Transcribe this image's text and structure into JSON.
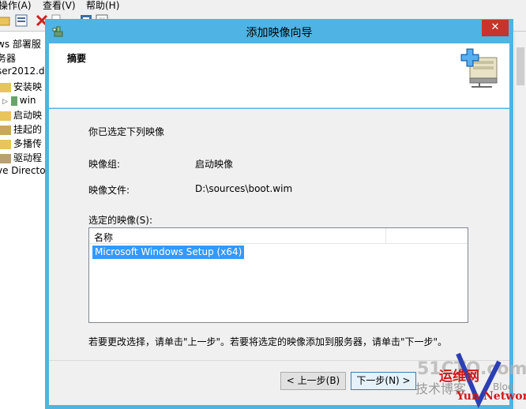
{
  "background": {
    "menu": [
      "操作(A)",
      "查看(V)",
      "帮助(H)"
    ],
    "tree": [
      "ws 部署服",
      "务器",
      "ser2012.d",
      "安装映",
      "win",
      "启动映",
      "挂起的",
      "多播传",
      "驱动程",
      "ve Directo"
    ]
  },
  "dialog": {
    "title": "添加映像向导",
    "close_glyph": "✕",
    "header_title": "摘要",
    "intro": "你已选定下列映像",
    "image_group_label": "映像组:",
    "image_group_value": "启动映像",
    "image_file_label": "映像文件:",
    "image_file_value": "D:\\sources\\boot.wim",
    "selected_label": "选定的映像(S):",
    "list_column": "名称",
    "list_items": [
      "Microsoft Windows Setup (x64)"
    ],
    "instruction": "若要更改选择，请单击\"上一步\"。若要将选定的映像添加到服务器，请单击\"下一步\"。",
    "back_button": "< 上一步(B)",
    "next_button": "下一步(N) >"
  },
  "watermark": {
    "line1": "51CTO.com",
    "line2": "运维网",
    "line3": "技术博客",
    "line4": "Yun Network",
    "line5": "Blog"
  },
  "colors": {
    "titlebar": "#4fb3e3",
    "close": "#c7342b",
    "selection": "#3399ff"
  }
}
